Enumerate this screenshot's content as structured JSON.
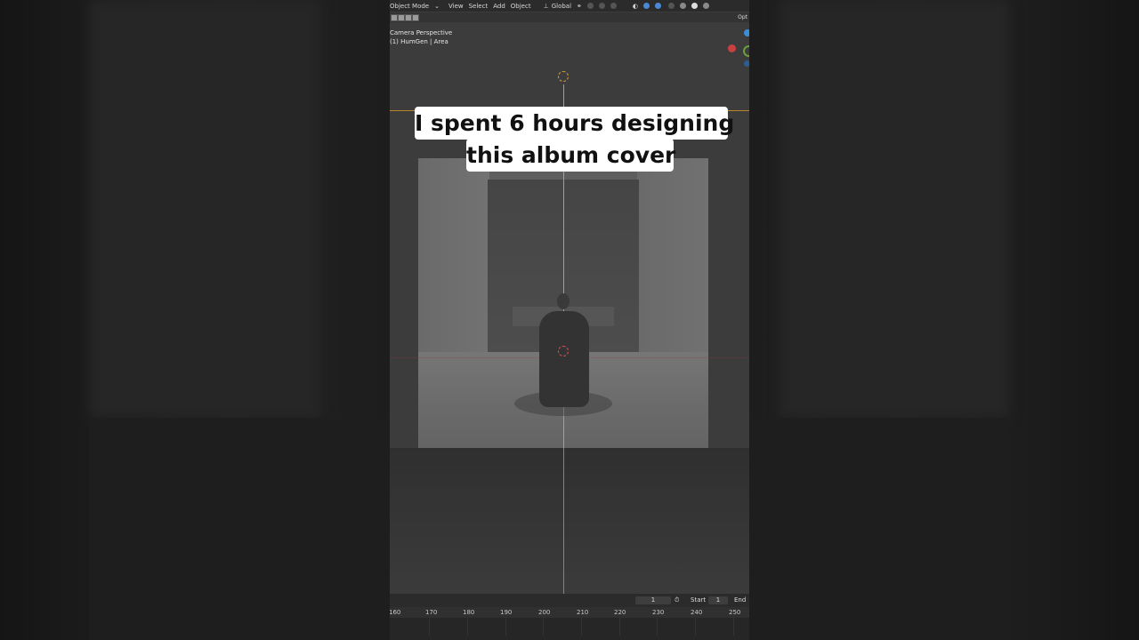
{
  "header": {
    "mode": "Object Mode",
    "menu": [
      "View",
      "Select",
      "Add",
      "Object"
    ],
    "orientation": "Global",
    "options_label": "Opt"
  },
  "viewport": {
    "camera_label": "Camera Perspective",
    "collection_label": "(1) HumGen | Area"
  },
  "caption": {
    "line1": "I spent 6 hours designing",
    "line2": "this album cover"
  },
  "timeline": {
    "current_frame": "1",
    "start_label": "Start",
    "start_value": "1",
    "end_label": "End",
    "ticks": [
      "160",
      "170",
      "180",
      "190",
      "200",
      "210",
      "220",
      "230",
      "240",
      "250"
    ]
  },
  "colors": {
    "accent_orange": "#b8862b",
    "axis_green": "#6aa03a",
    "gizmo_red": "#c84040",
    "gizmo_blue": "#3a8ed8"
  }
}
